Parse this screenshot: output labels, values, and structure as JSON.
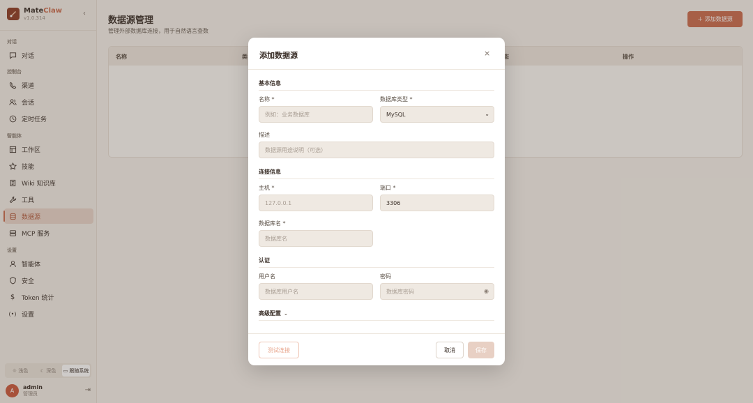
{
  "sidebar": {
    "brand_name_a": "Mate",
    "brand_name_b": "Claw",
    "version": "v1.0.314",
    "collapse_icon": "‹",
    "sections": {
      "chat": "对话",
      "console": "控制台",
      "agent": "智能体",
      "settings": "设置"
    },
    "items": {
      "chat": "对话",
      "channels": "渠道",
      "sessions": "会话",
      "cron": "定时任务",
      "workspace": "工作区",
      "skills": "技能",
      "wiki": "Wiki 知识库",
      "tools": "工具",
      "datasource": "数据源",
      "mcp": "MCP 服务",
      "agents": "智能体",
      "security": "安全",
      "token": "Token 统计",
      "setup": "设置"
    },
    "theme": {
      "light": "浅色",
      "dark": "深色",
      "system": "跟随系统"
    },
    "user": {
      "avatar": "A",
      "name": "admin",
      "role": "管理员"
    }
  },
  "main": {
    "title": "数据源管理",
    "subtitle": "管理外部数据库连接，用于自然语言查数",
    "add_button": "添加数据源",
    "table_headers": {
      "name": "名称",
      "type": "类",
      "status": "态",
      "actions": "操作"
    }
  },
  "modal": {
    "title": "添加数据源",
    "close": "×",
    "groups": {
      "basic": "基本信息",
      "connection": "连接信息",
      "auth": "认证",
      "advanced": "高级配置"
    },
    "fields": {
      "name": {
        "label": "名称 *",
        "placeholder": "例如：业务数据库"
      },
      "db_type": {
        "label": "数据库类型 *",
        "value": "MySQL"
      },
      "description": {
        "label": "描述",
        "placeholder": "数据源用途说明（可选）"
      },
      "host": {
        "label": "主机 *",
        "placeholder": "127.0.0.1"
      },
      "port": {
        "label": "端口 *",
        "value": "3306"
      },
      "db_name": {
        "label": "数据库名 *",
        "placeholder": "数据库名"
      },
      "username": {
        "label": "用户名",
        "placeholder": "数据库用户名"
      },
      "password": {
        "label": "密码",
        "placeholder": "数据库密码"
      }
    },
    "buttons": {
      "test": "测试连接",
      "cancel": "取消",
      "save": "保存"
    }
  },
  "colors": {
    "accent": "#c96a4c",
    "active_bg": "#e9d5c9"
  }
}
